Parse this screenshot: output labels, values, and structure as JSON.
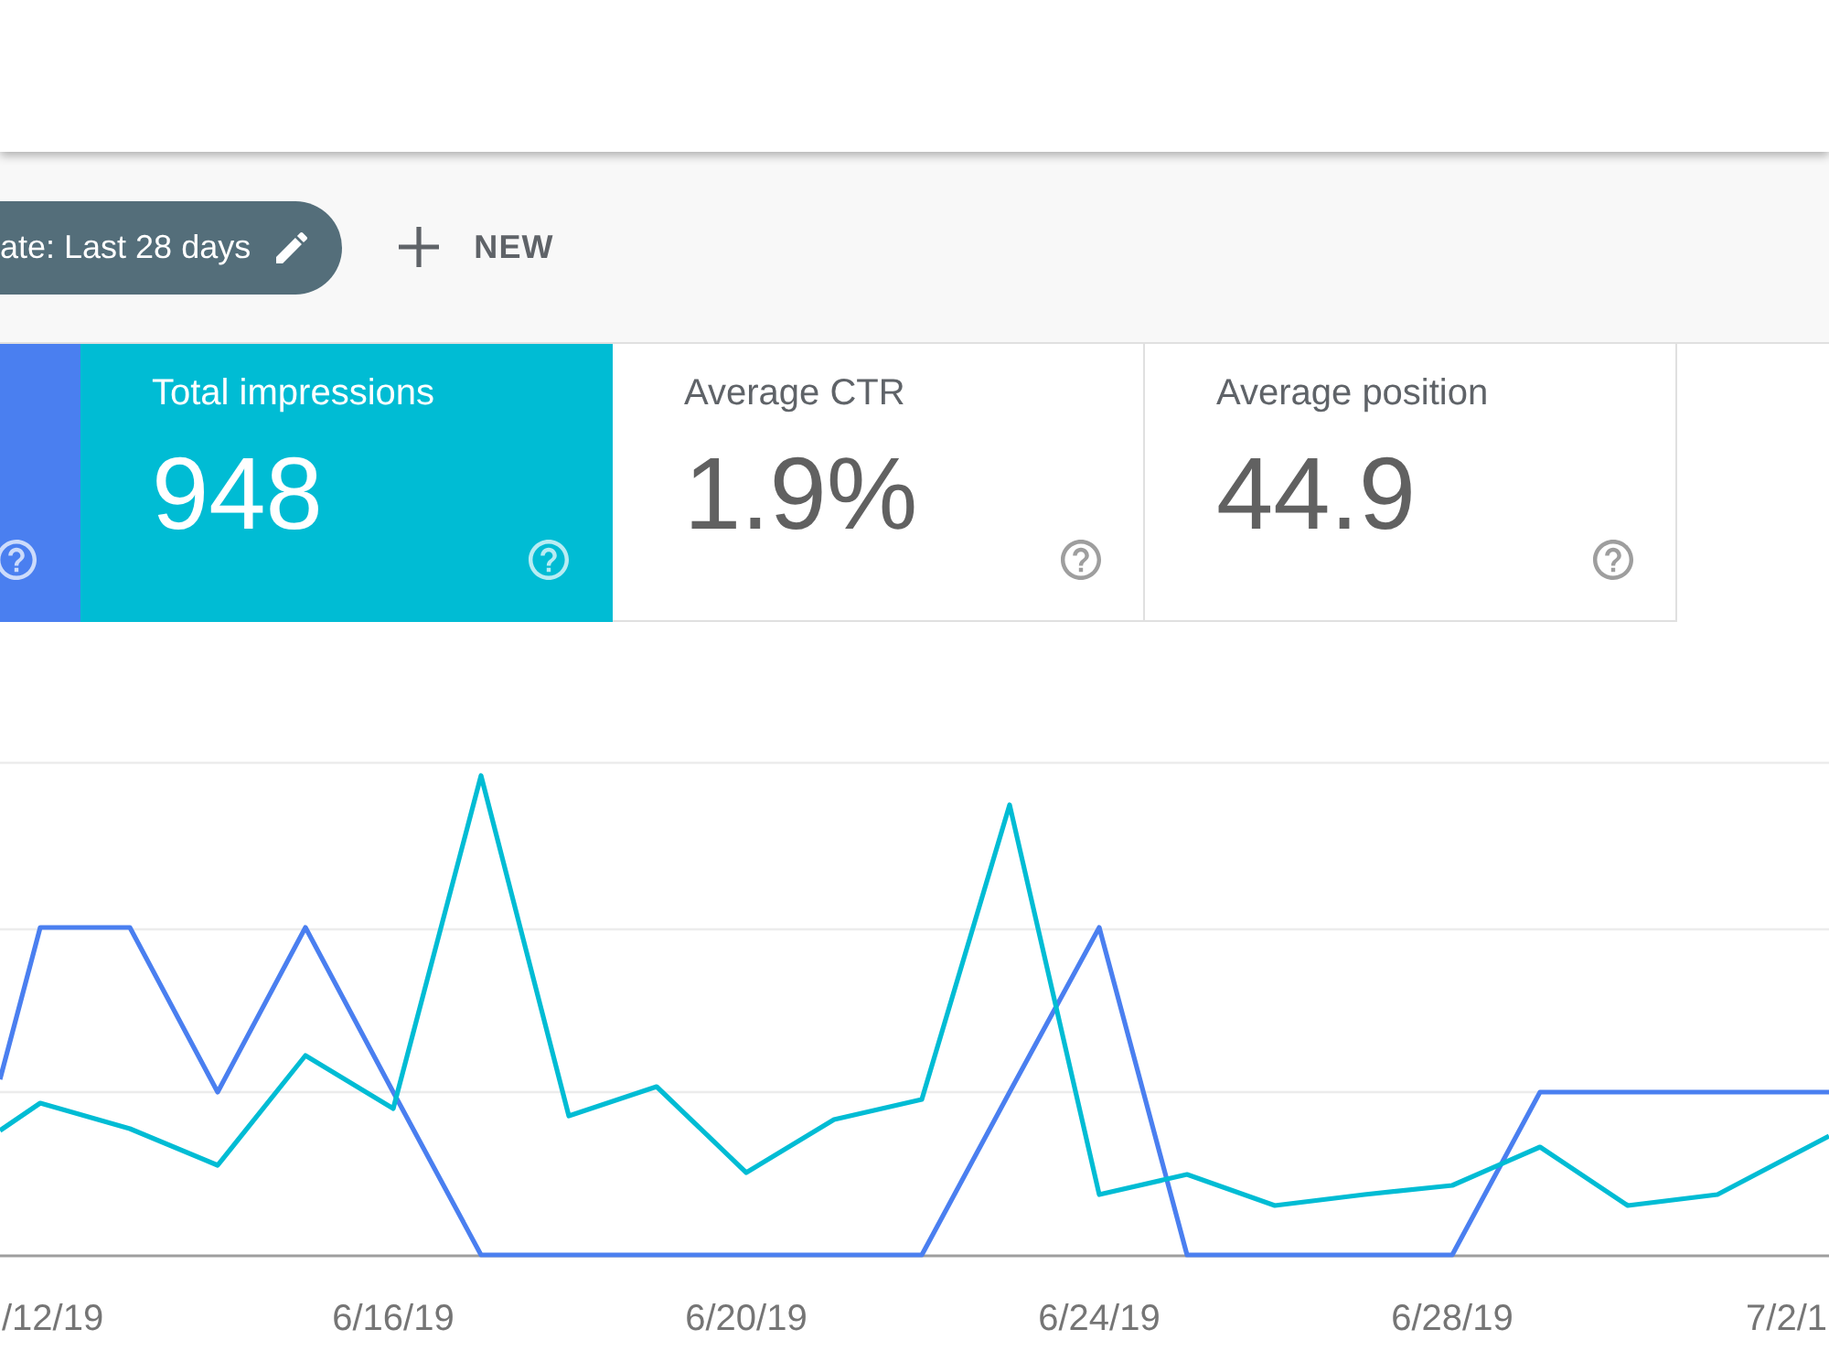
{
  "filter_bar": {
    "date_chip": {
      "label": "ate: Last 28 days"
    },
    "new_button": {
      "label": "NEW"
    }
  },
  "cards": [
    {
      "selected": true,
      "color": "#4a7ff0"
    },
    {
      "label": "Total impressions",
      "value": "948",
      "selected": true,
      "color": "#00bcd4"
    },
    {
      "label": "Average CTR",
      "value": "1.9%",
      "selected": false
    },
    {
      "label": "Average position",
      "value": "44.9",
      "selected": false
    }
  ],
  "chart": {
    "x_labels": [
      "/12/19",
      "6/16/19",
      "6/20/19",
      "6/24/19",
      "6/28/19",
      "7/2/1"
    ]
  }
}
